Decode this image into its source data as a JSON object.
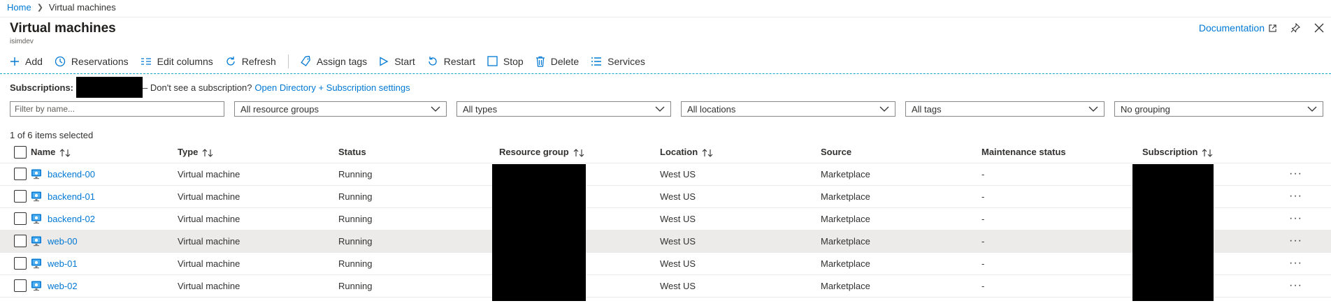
{
  "breadcrumb": {
    "home": "Home",
    "current": "Virtual machines"
  },
  "header": {
    "title": "Virtual machines",
    "subtitle": "isimdev",
    "documentation": "Documentation"
  },
  "toolbar": {
    "add": "Add",
    "reservations": "Reservations",
    "edit_columns": "Edit columns",
    "refresh": "Refresh",
    "assign_tags": "Assign tags",
    "start": "Start",
    "restart": "Restart",
    "stop": "Stop",
    "delete": "Delete",
    "services": "Services"
  },
  "subscriptions": {
    "label": "Subscriptions:",
    "question": "– Don't see a subscription?",
    "link": "Open Directory + Subscription settings"
  },
  "filters": {
    "name_placeholder": "Filter by name...",
    "resource_groups": "All resource groups",
    "types": "All types",
    "locations": "All locations",
    "tags": "All tags",
    "grouping": "No grouping"
  },
  "selection_count": "1 of 6 items selected",
  "columns": {
    "name": "Name",
    "type": "Type",
    "status": "Status",
    "resource_group": "Resource group",
    "location": "Location",
    "source": "Source",
    "maintenance": "Maintenance status",
    "subscription": "Subscription"
  },
  "rows": [
    {
      "name": "backend-00",
      "type": "Virtual machine",
      "status": "Running",
      "location": "West US",
      "source": "Marketplace",
      "maintenance": "-",
      "more": "···"
    },
    {
      "name": "backend-01",
      "type": "Virtual machine",
      "status": "Running",
      "location": "West US",
      "source": "Marketplace",
      "maintenance": "-",
      "more": "···"
    },
    {
      "name": "backend-02",
      "type": "Virtual machine",
      "status": "Running",
      "location": "West US",
      "source": "Marketplace",
      "maintenance": "-",
      "more": "···"
    },
    {
      "name": "web-00",
      "type": "Virtual machine",
      "status": "Running",
      "location": "West US",
      "source": "Marketplace",
      "maintenance": "-",
      "more": "···"
    },
    {
      "name": "web-01",
      "type": "Virtual machine",
      "status": "Running",
      "location": "West US",
      "source": "Marketplace",
      "maintenance": "-",
      "more": "···"
    },
    {
      "name": "web-02",
      "type": "Virtual machine",
      "status": "Running",
      "location": "West US",
      "source": "Marketplace",
      "maintenance": "-",
      "more": "···"
    }
  ],
  "selected_row": "web-00",
  "colors": {
    "accent": "#0078d4",
    "selected_row": "#edebe9"
  }
}
